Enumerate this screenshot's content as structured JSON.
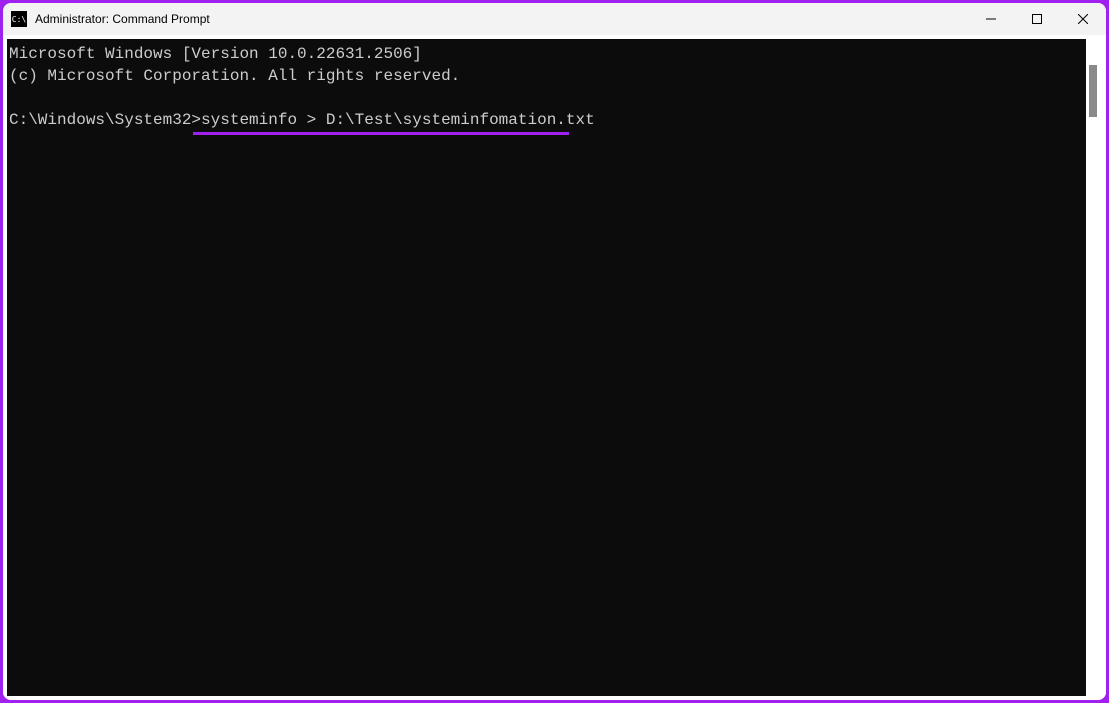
{
  "window": {
    "title": "Administrator: Command Prompt",
    "icon_glyph": "C:\\"
  },
  "console": {
    "line1": "Microsoft Windows [Version 10.0.22631.2506]",
    "line2": "(c) Microsoft Corporation. All rights reserved.",
    "blank": "",
    "prompt": "C:\\Windows\\System32>",
    "command": "systeminfo > D:\\Test\\systeminfomation.txt"
  },
  "colors": {
    "accent": "#A020F0",
    "console_bg": "#0C0C0C",
    "console_fg": "#CCCCCC"
  }
}
